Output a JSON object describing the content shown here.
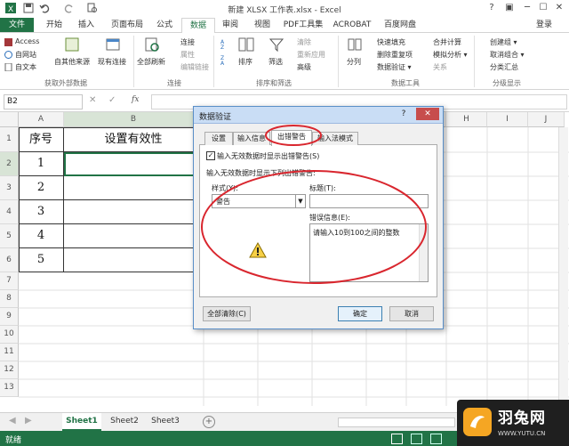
{
  "window": {
    "title": "新建 XLSX 工作表.xlsx - Excel",
    "controls": [
      "?",
      "▣",
      "─",
      "☐",
      "✕"
    ],
    "user": "登录"
  },
  "tabs": [
    "文件",
    "开始",
    "插入",
    "页面布局",
    "公式",
    "数据",
    "审阅",
    "视图",
    "PDF工具集",
    "ACROBAT",
    "百度网盘"
  ],
  "ribbon": {
    "get_external": {
      "items": [
        "Access",
        "自网站",
        "自文本"
      ],
      "other": "自其他来源",
      "existing": "现有连接",
      "group": "获取外部数据"
    },
    "connections": {
      "refresh": "全部刷新",
      "items": [
        "连接",
        "属性",
        "编辑链接"
      ],
      "group": "连接"
    },
    "sort_filter": {
      "sort": "排序",
      "filter": "筛选",
      "items": [
        "清除",
        "重新应用",
        "高级"
      ],
      "group": "排序和筛选"
    },
    "data_tools": {
      "split": "分列",
      "items": [
        "快速填充",
        "删除重复项",
        "数据验证 ▾"
      ],
      "items2": [
        "合并计算",
        "模拟分析 ▾",
        "关系"
      ],
      "group": "数据工具"
    },
    "outline": {
      "items": [
        "创建组 ▾",
        "取消组合 ▾",
        "分类汇总"
      ],
      "group": "分级显示"
    }
  },
  "formula_bar": {
    "name_box": "B2",
    "fx": "fx"
  },
  "grid": {
    "columns": [
      "A",
      "B",
      "C",
      "D",
      "E",
      "F",
      "G",
      "H",
      "I",
      "J"
    ],
    "rows": [
      "1",
      "2",
      "3",
      "4",
      "5",
      "6",
      "7",
      "8",
      "9",
      "10",
      "11",
      "12",
      "13"
    ],
    "header_a": "序号",
    "header_b": "设置有效性",
    "numbers": [
      "1",
      "2",
      "3",
      "4",
      "5"
    ]
  },
  "sheets": [
    "Sheet1",
    "Sheet2",
    "Sheet3"
  ],
  "status": "就绪",
  "dialog": {
    "title": "数据验证",
    "title_controls": [
      "?",
      "✕"
    ],
    "tabs": [
      "设置",
      "输入信息",
      "出错警告",
      "输入法模式"
    ],
    "checkbox_label": "输入无效数据时显示出错警告(S)",
    "section_label": "输入无效数据时显示下列出错警告:",
    "style_label": "样式(Y):",
    "style_value": "警告",
    "title_label": "标题(T):",
    "title_value": "",
    "error_label": "错误信息(E):",
    "error_value": "请输入10到100之间的整数",
    "clear_all": "全部清除(C)",
    "ok": "确定",
    "cancel": "取消"
  },
  "watermark": {
    "brand": "羽兔网",
    "url": "WWW.YUTU.CN"
  },
  "colors": {
    "excel_green": "#217346",
    "annotation_red": "#d9262e"
  }
}
